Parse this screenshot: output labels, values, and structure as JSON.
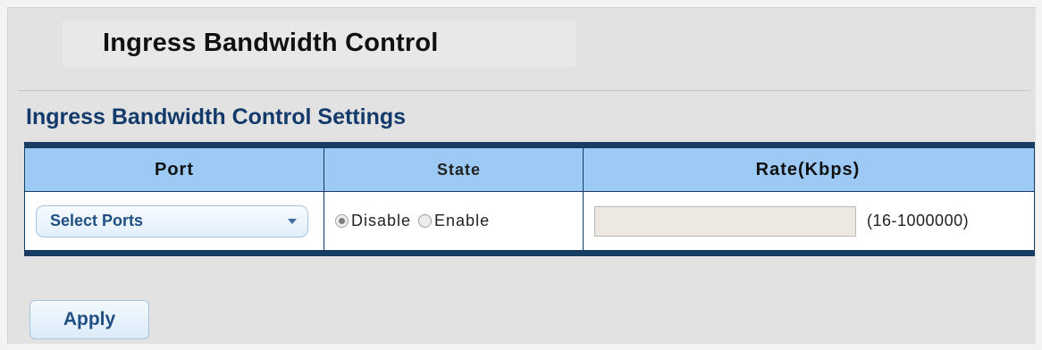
{
  "page": {
    "title": "Ingress Bandwidth Control",
    "section_title": "Ingress Bandwidth Control Settings"
  },
  "table": {
    "headers": {
      "port": "Port",
      "state": "State",
      "rate": "Rate(Kbps)"
    },
    "row": {
      "port_select": {
        "selected": "Select Ports",
        "icon": "caret-down"
      },
      "state_options": [
        {
          "label": "Disable",
          "checked": true
        },
        {
          "label": "Enable",
          "checked": false
        }
      ],
      "rate_value": "",
      "rate_hint": "(16-1000000)"
    }
  },
  "actions": {
    "apply_label": "Apply"
  },
  "colors": {
    "header_bg": "#9ccaf5",
    "table_border": "#193d62",
    "section_title": "#123a6a",
    "button_text": "#1f4f83"
  }
}
